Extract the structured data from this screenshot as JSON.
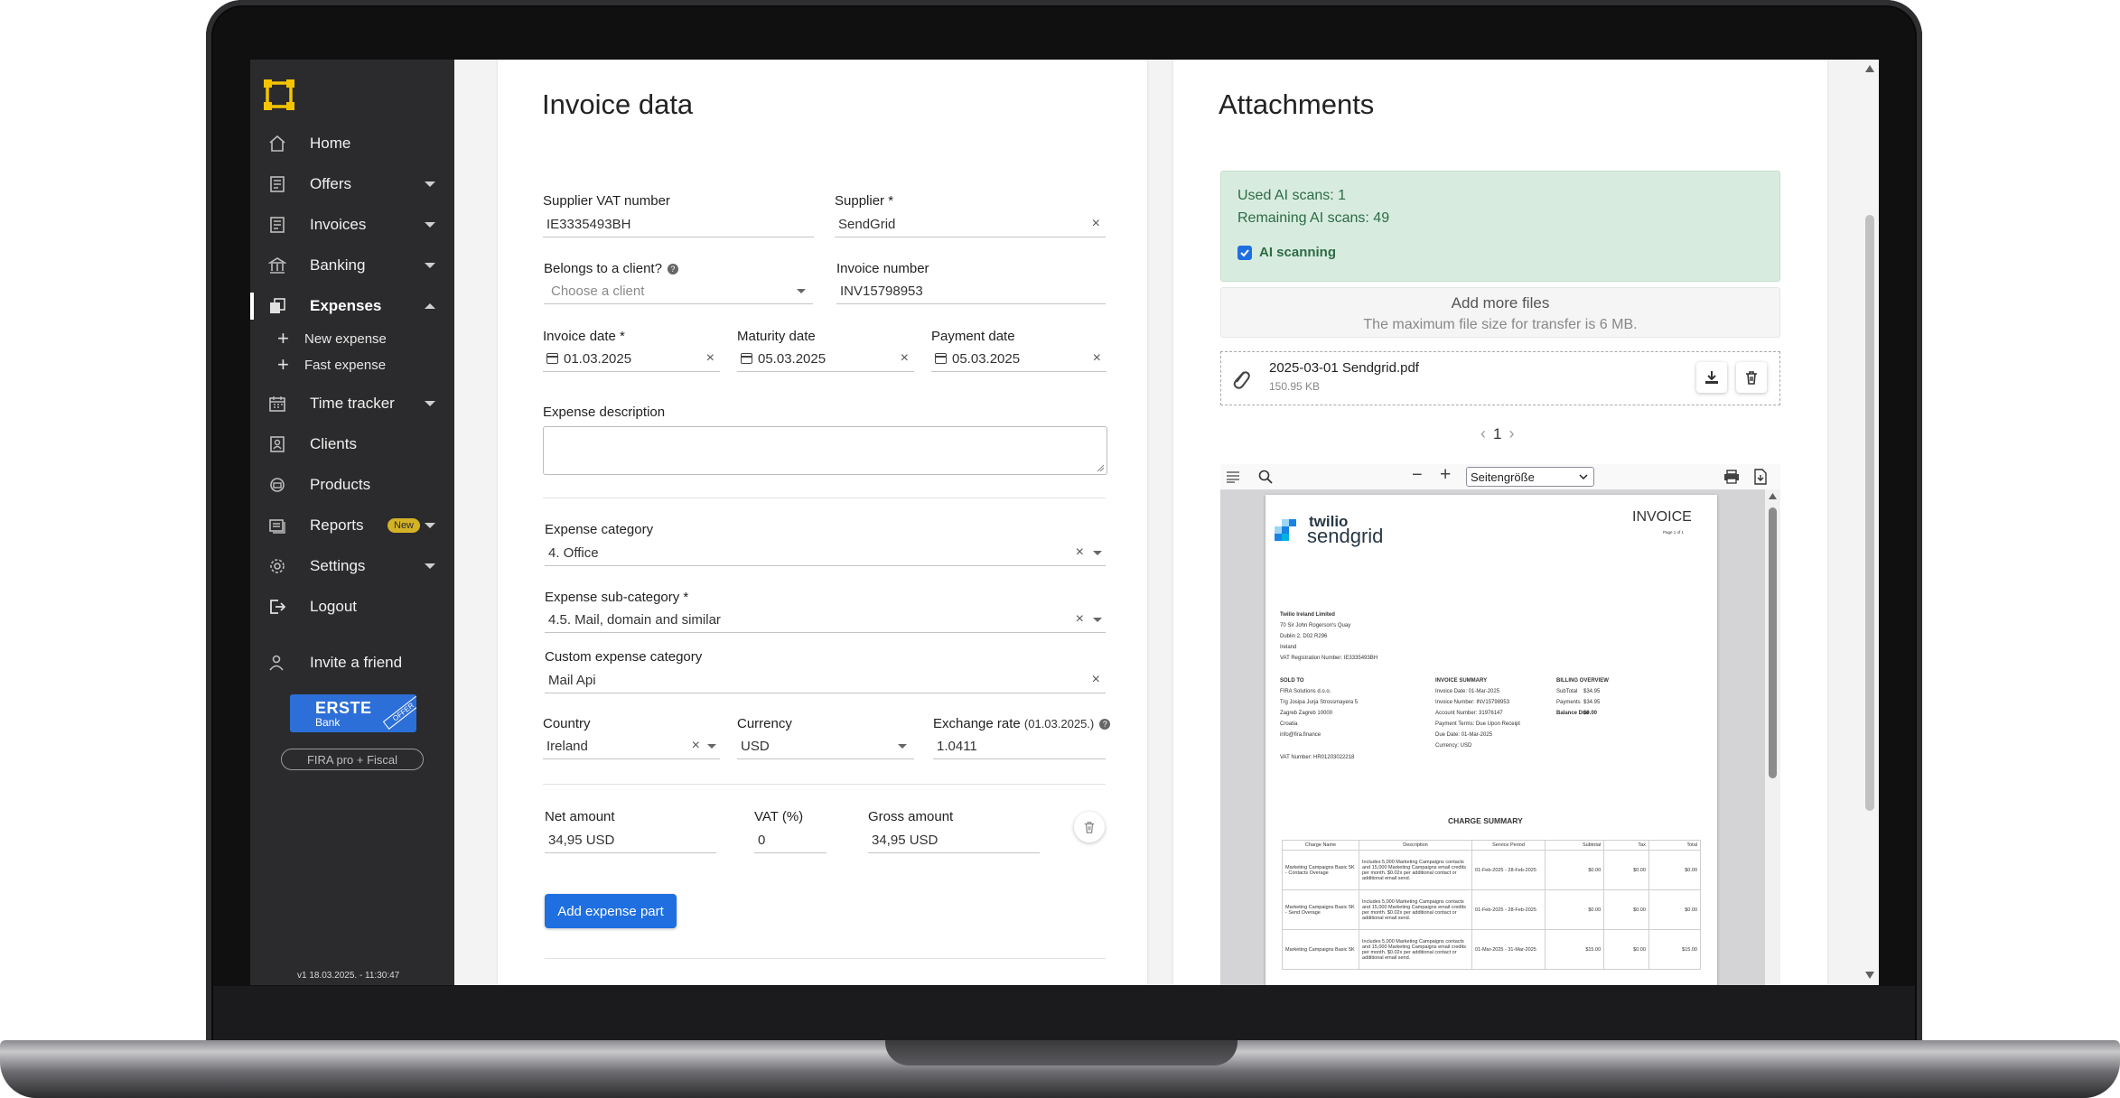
{
  "sidebar": {
    "items": [
      {
        "label": "Home",
        "icon": "home-icon"
      },
      {
        "label": "Offers",
        "icon": "offers-icon"
      },
      {
        "label": "Invoices",
        "icon": "invoices-icon"
      },
      {
        "label": "Banking",
        "icon": "bank-icon"
      },
      {
        "label": "Expenses",
        "icon": "expenses-icon"
      },
      {
        "label": "Time tracker",
        "icon": "calendar-icon"
      },
      {
        "label": "Clients",
        "icon": "clients-icon"
      },
      {
        "label": "Products",
        "icon": "products-icon"
      },
      {
        "label": "Reports",
        "icon": "reports-icon"
      },
      {
        "label": "Settings",
        "icon": "gear-icon"
      },
      {
        "label": "Logout",
        "icon": "logout-icon"
      },
      {
        "label": "Invite a friend",
        "icon": "invite-friend-icon"
      }
    ],
    "sub_items": [
      "New expense",
      "Fast expense"
    ],
    "reports_badge": "New",
    "erste": {
      "name": "ERSTE",
      "sub": "Bank",
      "ribbon": "OFFER"
    },
    "fira_button": "FIRA pro + Fiscal",
    "version": "v1 18.03.2025. - 11:30:47"
  },
  "invoice": {
    "title": "Invoice data",
    "supplier_vat": {
      "label": "Supplier VAT number",
      "value": "IE3335493BH"
    },
    "supplier": {
      "label": "Supplier *",
      "value": "SendGrid"
    },
    "belongs_client": {
      "label": "Belongs to a client?",
      "placeholder": "Choose a client"
    },
    "invoice_number": {
      "label": "Invoice number",
      "value": "INV15798953"
    },
    "invoice_date": {
      "label": "Invoice date *",
      "value": "01.03.2025"
    },
    "maturity_date": {
      "label": "Maturity date",
      "value": "05.03.2025"
    },
    "payment_date": {
      "label": "Payment date",
      "value": "05.03.2025"
    },
    "description": {
      "label": "Expense description",
      "value": ""
    },
    "category": {
      "label": "Expense category",
      "value": "4. Office"
    },
    "subcategory": {
      "label": "Expense sub-category *",
      "value": "4.5. Mail, domain and similar"
    },
    "custom_category": {
      "label": "Custom expense category",
      "value": "Mail Api"
    },
    "country": {
      "label": "Country",
      "value": "Ireland"
    },
    "currency": {
      "label": "Currency",
      "value": "USD"
    },
    "exchange_rate": {
      "label": "Exchange rate",
      "hint": "(01.03.2025.)",
      "value": "1.0411"
    },
    "net_amount": {
      "label": "Net amount",
      "value": "34,95 USD"
    },
    "vat": {
      "label": "VAT (%)",
      "value": "0"
    },
    "gross_amount": {
      "label": "Gross amount",
      "value": "34,95 USD"
    },
    "add_part_button": "Add expense part"
  },
  "attachments": {
    "title": "Attachments",
    "used_scans": "Used AI scans: 1",
    "remaining_scans": "Remaining AI scans: 49",
    "ai_scanning_label": "AI scanning",
    "ai_scanning_checked": true,
    "add_files": "Add more files",
    "max_size": "The maximum file size for transfer is 6 MB.",
    "file": {
      "name": "2025-03-01 Sendgrid.pdf",
      "size": "150.95 KB"
    },
    "page": "1",
    "viewer": {
      "zoom": "Seitengröße",
      "brand_top": "twilio",
      "brand_bottom": "sendgrid",
      "doc_title": "INVOICE",
      "page_of": "Page 1 of 1",
      "company": "Twilio Ireland Limited",
      "addr1": "70 Sir John Rogerson's Quay",
      "addr2": "Dublin 2, D02 R296",
      "addr3": "Ireland",
      "vat_reg": "VAT Registration Number: IE3335493BH",
      "sold_to": "SOLD TO",
      "buyer1": "FIRA Solutions d.o.o.",
      "buyer2": "Trg Josipa Jurja Strossmayera 5",
      "buyer3": "Zagreb Zagreb 10000",
      "buyer4": "Croatia",
      "buyer5": "info@fira.finance",
      "buyer_vat": "VAT Number: HR01203022218",
      "summary_head": "INVOICE SUMMARY",
      "summary": [
        "Invoice Date: 01-Mar-2025",
        "Invoice Number: INV15798953",
        "Account Number: 31976147",
        "Payment Terms: Due Upon Receipt",
        "Due Date: 01-Mar-2025",
        "Currency: USD"
      ],
      "billing_head": "BILLING OVERVIEW",
      "billing": [
        {
          "k": "SubTotal",
          "v": "$34.95"
        },
        {
          "k": "Payments",
          "v": "$34.95"
        },
        {
          "k": "Balance Due",
          "v": "$0.00"
        }
      ],
      "charge_summary": "CHARGE SUMMARY",
      "table_headers": [
        "Charge Name",
        "Description",
        "Service Period",
        "Subtotal",
        "Tax",
        "Total"
      ],
      "rows": [
        {
          "name": "Marketing Campaigns Basic 5K - Contacts Overage",
          "desc": "Includes 5,000 Marketing Campaigns contacts and 15,000 Marketing Campaigns email credits per month. $0.02x per additional contact or additional email send.",
          "period": "01-Feb-2025 - 28-Feb-2025",
          "sub": "$0.00",
          "tax": "$0.00",
          "total": "$0.00"
        },
        {
          "name": "Marketing Campaigns Basic 5K - Send Overage",
          "desc": "Includes 5,000 Marketing Campaigns contacts and 15,000 Marketing Campaigns email credits per month. $0.02x per additional contact or additional email send.",
          "period": "01-Feb-2025 - 28-Feb-2025",
          "sub": "$0.00",
          "tax": "$0.00",
          "total": "$0.00"
        },
        {
          "name": "Marketing Campaigns Basic 5K",
          "desc": "Includes 5,000 Marketing Campaigns contacts and 15,000 Marketing Campaigns email credits per month. $0.02x per additional contact or additional email send.",
          "period": "01-Mar-2025 - 31-Mar-2025",
          "sub": "$15.00",
          "tax": "$0.00",
          "total": "$15.00"
        }
      ]
    }
  },
  "colors": {
    "sidebar": "#2b2b2d",
    "accent": "#1f6fe0",
    "logo": "#f5c400",
    "ai_box": "#d7ecdf"
  }
}
